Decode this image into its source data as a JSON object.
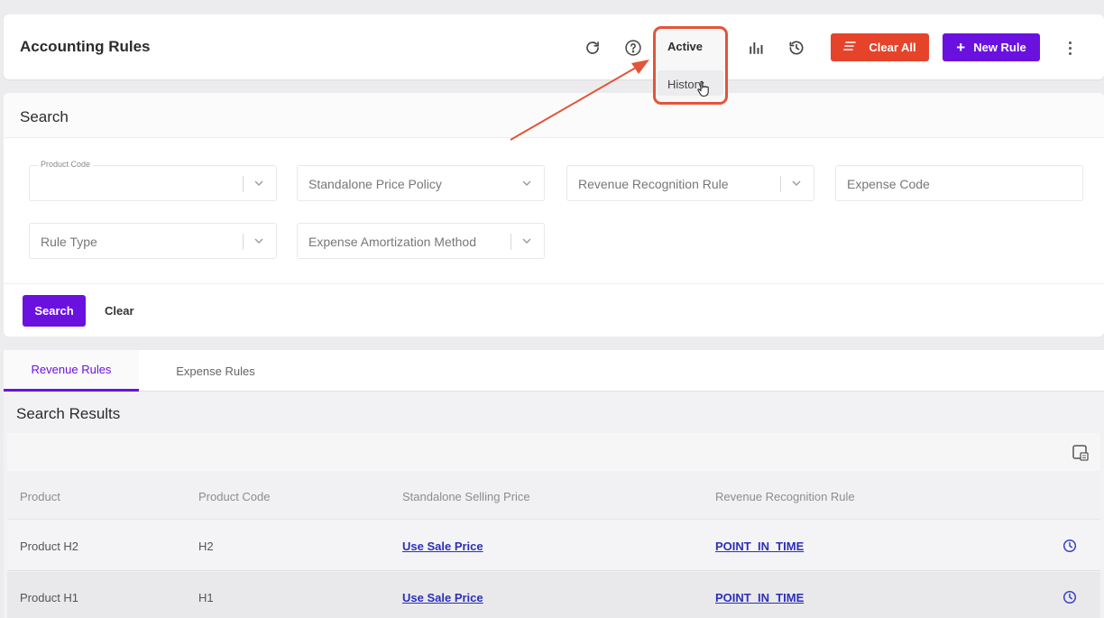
{
  "header": {
    "title": "Accounting Rules",
    "icons": [
      "refresh-icon",
      "help-icon",
      "bar-chart-icon",
      "history-icon"
    ],
    "clear_all_label": "Clear All",
    "new_rule_label": "New Rule"
  },
  "dropdown": {
    "options": [
      "Active",
      "History"
    ]
  },
  "search": {
    "title": "Search",
    "fields": {
      "product_code": {
        "label": "Product Code",
        "value": ""
      },
      "standalone_price_policy": "Standalone Price Policy",
      "revenue_recognition_rule": "Revenue Recognition Rule",
      "expense_code": "Expense Code",
      "rule_type": "Rule Type",
      "expense_amortization_method": "Expense Amortization Method"
    },
    "search_label": "Search",
    "clear_label": "Clear"
  },
  "tabs": [
    "Revenue Rules",
    "Expense Rules"
  ],
  "results": {
    "title": "Search Results",
    "columns": [
      "Product",
      "Product Code",
      "Standalone Selling Price",
      "Revenue Recognition Rule"
    ],
    "rows": [
      {
        "product": "Product H2",
        "code": "H2",
        "price": "Use Sale Price",
        "rule": "POINT_IN_TIME"
      },
      {
        "product": "Product H1",
        "code": "H1",
        "price": "Use Sale Price",
        "rule": "POINT_IN_TIME"
      }
    ]
  },
  "colors": {
    "accent": "#6a11e0",
    "danger": "#e5442b",
    "highlight": "#e2553a",
    "link": "#2b2fb8"
  }
}
